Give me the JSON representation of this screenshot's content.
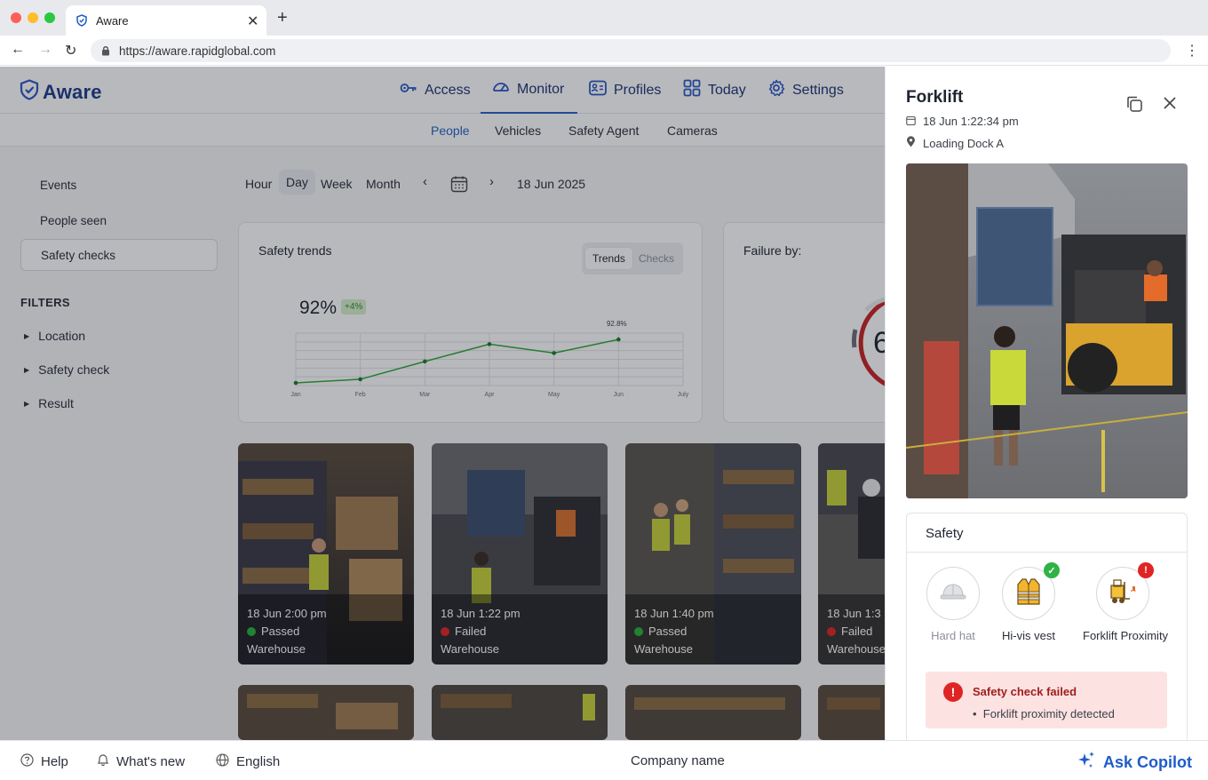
{
  "browser": {
    "tab_title": "Aware",
    "url": "https://aware.rapidglobal.com"
  },
  "app": {
    "logo_text": "Aware",
    "nav": [
      {
        "label": "Access",
        "icon": "key-icon"
      },
      {
        "label": "Monitor",
        "icon": "gauge-icon",
        "active": true
      },
      {
        "label": "Profiles",
        "icon": "id-card-icon"
      },
      {
        "label": "Today",
        "icon": "grid-icon"
      },
      {
        "label": "Settings",
        "icon": "gear-icon"
      }
    ],
    "subnav": [
      "People",
      "Vehicles",
      "Safety Agent",
      "Cameras"
    ],
    "sidebar": [
      "Events",
      "People seen",
      "Safety checks"
    ],
    "filters_title": "FILTERS",
    "filters": [
      "Location",
      "Safety check",
      "Result"
    ],
    "time_range": [
      "Hour",
      "Day",
      "Week",
      "Month"
    ],
    "date": "18 Jun 2025"
  },
  "trends": {
    "title": "Safety trends",
    "toggle": [
      "Trends",
      "Checks"
    ],
    "kpi": "92%",
    "kpi_change": "+4%",
    "last_label": "92.8%"
  },
  "chart_data": {
    "type": "line",
    "categories": [
      "Jan",
      "Feb",
      "Mar",
      "Apr",
      "May",
      "Jun",
      "July"
    ],
    "values": [
      84.5,
      85.2,
      88.6,
      91.9,
      90.2,
      92.8
    ]
  },
  "failure": {
    "title": "Failure by:"
  },
  "thumbnails": [
    {
      "time": "18 Jun 2:00 pm",
      "status": "Passed",
      "location": "Warehouse"
    },
    {
      "time": "18 Jun 1:22 pm",
      "status": "Failed",
      "location": "Warehouse"
    },
    {
      "time": "18 Jun 1:40 pm",
      "status": "Passed",
      "location": "Warehouse"
    },
    {
      "time": "18 Jun 1:3",
      "status": "Failed",
      "location": "Warehouse"
    }
  ],
  "panel": {
    "title": "Forklift",
    "datetime": "18 Jun 1:22:34 pm",
    "location": "Loading Dock A",
    "safety_title": "Safety",
    "checks": [
      "Hard hat",
      "Hi-vis vest",
      "Forklift Proximity"
    ],
    "alert_title": "Safety check failed",
    "alert_item": "Forklift proximity detected"
  },
  "footer": {
    "help": "Help",
    "whats_new": "What's new",
    "language": "English",
    "company": "Company name",
    "copilot": "Ask Copilot"
  },
  "colors": {
    "accent": "#2563c9",
    "pass": "#27b03a",
    "fail": "#e02424"
  }
}
